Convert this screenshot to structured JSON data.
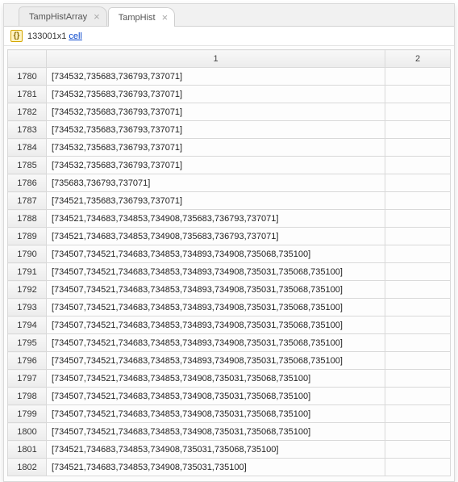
{
  "tabs": [
    {
      "label": "TampHistArray",
      "active": false
    },
    {
      "label": "TampHist",
      "active": true
    }
  ],
  "info": {
    "dims": "133001x1",
    "type_link": "cell"
  },
  "columns": [
    "1",
    "2"
  ],
  "rows": [
    {
      "idx": "1780",
      "c1": "[734532,735683,736793,737071]",
      "c2": ""
    },
    {
      "idx": "1781",
      "c1": "[734532,735683,736793,737071]",
      "c2": ""
    },
    {
      "idx": "1782",
      "c1": "[734532,735683,736793,737071]",
      "c2": ""
    },
    {
      "idx": "1783",
      "c1": "[734532,735683,736793,737071]",
      "c2": ""
    },
    {
      "idx": "1784",
      "c1": "[734532,735683,736793,737071]",
      "c2": ""
    },
    {
      "idx": "1785",
      "c1": "[734532,735683,736793,737071]",
      "c2": ""
    },
    {
      "idx": "1786",
      "c1": "[735683,736793,737071]",
      "c2": ""
    },
    {
      "idx": "1787",
      "c1": "[734521,735683,736793,737071]",
      "c2": ""
    },
    {
      "idx": "1788",
      "c1": "[734521,734683,734853,734908,735683,736793,737071]",
      "c2": ""
    },
    {
      "idx": "1789",
      "c1": "[734521,734683,734853,734908,735683,736793,737071]",
      "c2": ""
    },
    {
      "idx": "1790",
      "c1": "[734507,734521,734683,734853,734893,734908,735068,735100]",
      "c2": ""
    },
    {
      "idx": "1791",
      "c1": "[734507,734521,734683,734853,734893,734908,735031,735068,735100]",
      "c2": ""
    },
    {
      "idx": "1792",
      "c1": "[734507,734521,734683,734853,734893,734908,735031,735068,735100]",
      "c2": ""
    },
    {
      "idx": "1793",
      "c1": "[734507,734521,734683,734853,734893,734908,735031,735068,735100]",
      "c2": ""
    },
    {
      "idx": "1794",
      "c1": "[734507,734521,734683,734853,734893,734908,735031,735068,735100]",
      "c2": ""
    },
    {
      "idx": "1795",
      "c1": "[734507,734521,734683,734853,734893,734908,735031,735068,735100]",
      "c2": ""
    },
    {
      "idx": "1796",
      "c1": "[734507,734521,734683,734853,734893,734908,735031,735068,735100]",
      "c2": ""
    },
    {
      "idx": "1797",
      "c1": "[734507,734521,734683,734853,734908,735031,735068,735100]",
      "c2": ""
    },
    {
      "idx": "1798",
      "c1": "[734507,734521,734683,734853,734908,735031,735068,735100]",
      "c2": ""
    },
    {
      "idx": "1799",
      "c1": "[734507,734521,734683,734853,734908,735031,735068,735100]",
      "c2": ""
    },
    {
      "idx": "1800",
      "c1": "[734507,734521,734683,734853,734908,735031,735068,735100]",
      "c2": ""
    },
    {
      "idx": "1801",
      "c1": "[734521,734683,734853,734908,735031,735068,735100]",
      "c2": ""
    },
    {
      "idx": "1802",
      "c1": "[734521,734683,734853,734908,735031,735100]",
      "c2": ""
    }
  ]
}
